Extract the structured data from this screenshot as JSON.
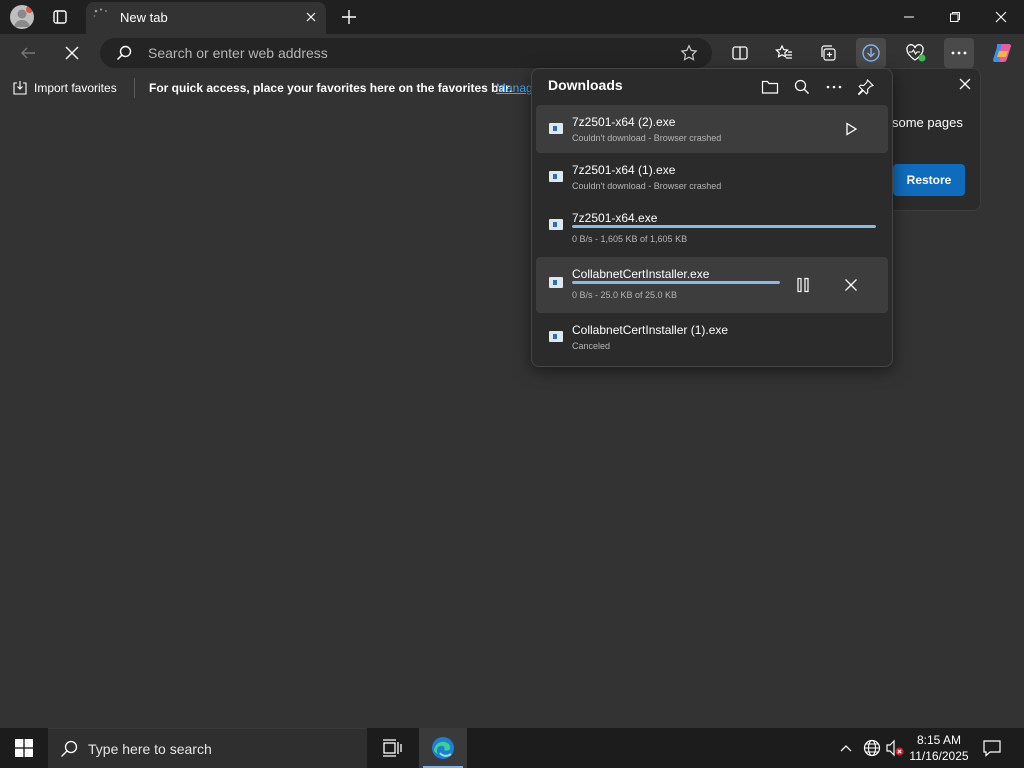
{
  "browser": {
    "tab_title": "New tab",
    "address_placeholder": "Search or enter web address"
  },
  "favorites_bar": {
    "import_label": "Import favorites",
    "hint": "For quick access, place your favorites here on the favorites bar.",
    "manage_link": "Manage favorites now"
  },
  "restore_popup": {
    "text": "some pages",
    "button": "Restore"
  },
  "downloads": {
    "title": "Downloads",
    "items": [
      {
        "name": "7z2501-x64 (2).exe",
        "status": "Couldn't download - Browser crashed"
      },
      {
        "name": "7z2501-x64 (1).exe",
        "status": "Couldn't download - Browser crashed"
      },
      {
        "name": "7z2501-x64.exe",
        "status": "0 B/s - 1,605 KB of 1,605 KB",
        "progress": 1.0
      },
      {
        "name": "CollabnetCertInstaller.exe",
        "status": "0 B/s - 25.0 KB of 25.0 KB",
        "progress": 1.0
      },
      {
        "name": "CollabnetCertInstaller (1).exe",
        "status": "Canceled"
      }
    ]
  },
  "taskbar": {
    "search_placeholder": "Type here to search",
    "time": "8:15 AM",
    "date": "11/16/2025"
  },
  "colors": {
    "accent": "#0f6cbd",
    "link": "#4aa3ef",
    "progress": "#8cb8e8"
  }
}
